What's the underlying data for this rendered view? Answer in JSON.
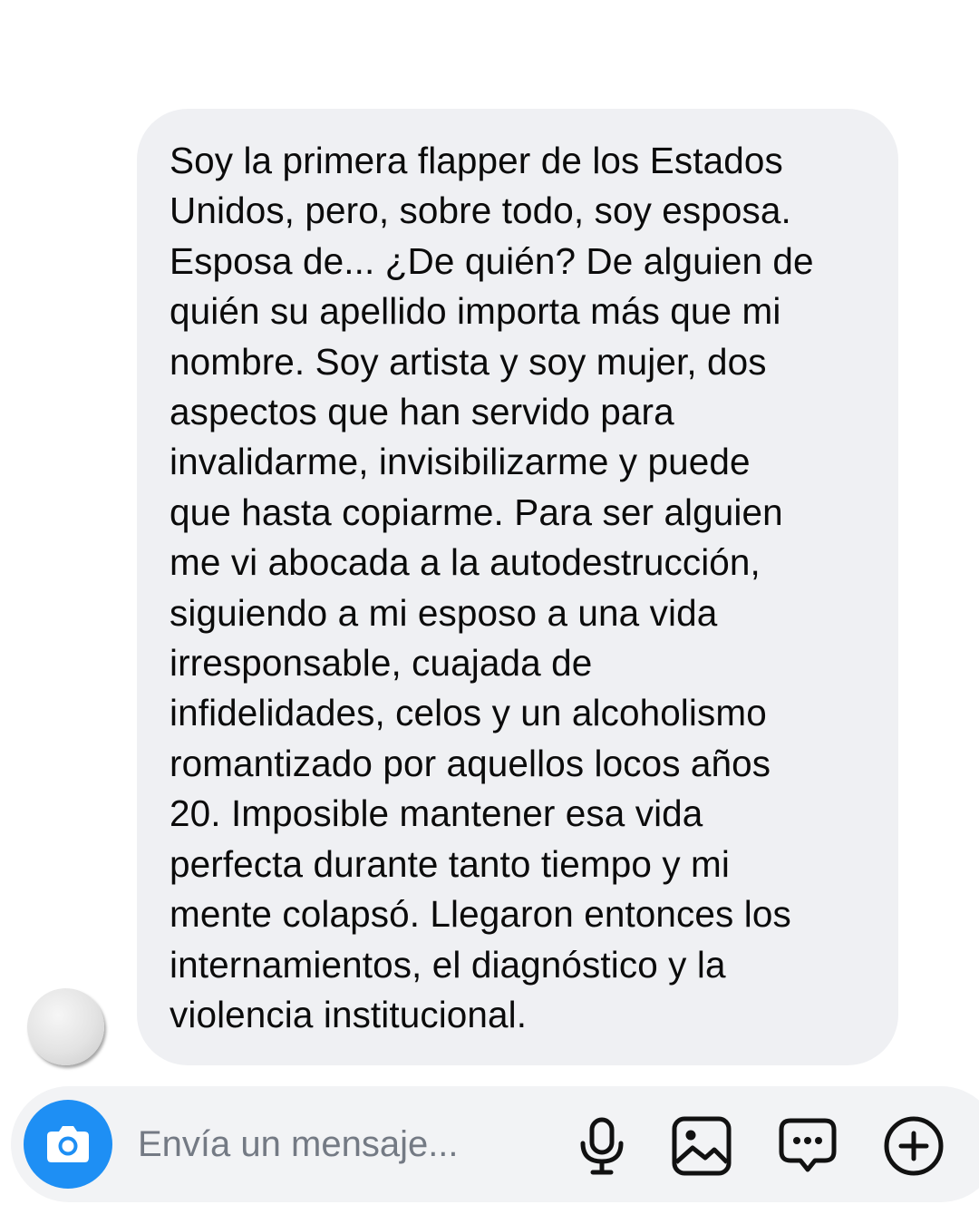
{
  "conversation": {
    "message_lines": [
      "Soy la primera flapper de los Estados",
      "Unidos, pero, sobre todo, soy esposa.",
      "Esposa de... ¿De quién? De alguien de",
      "quién su apellido importa más que mi",
      "nombre. Soy artista y soy mujer, dos",
      "aspectos que han servido para",
      "invalidarme, invisibilizarme y puede",
      "que hasta copiarme. Para ser alguien",
      "me vi abocada a la autodestrucción,",
      "siguiendo a mi esposo a una vida",
      "irresponsable, cuajada de",
      "infidelidades, celos y un alcoholismo",
      "romantizado por aquellos locos años",
      "20. Imposible mantener esa vida",
      "perfecta durante tanto tiempo y mi",
      "mente colapsó. Llegaron entonces los",
      "internamientos, el diagnóstico y la",
      "violencia institucional."
    ]
  },
  "composer": {
    "placeholder": "Envía un mensaje...",
    "value": "",
    "icons": {
      "camera": "camera-icon",
      "mic": "microphone-icon",
      "gallery": "image-icon",
      "sticker": "chat-bubble-dots-icon",
      "add": "plus-circle-icon"
    }
  },
  "colors": {
    "bubble_background": "#eff0f3",
    "camera_button": "#1e8ff4",
    "placeholder_text": "#747a84",
    "icon": "#111111"
  }
}
